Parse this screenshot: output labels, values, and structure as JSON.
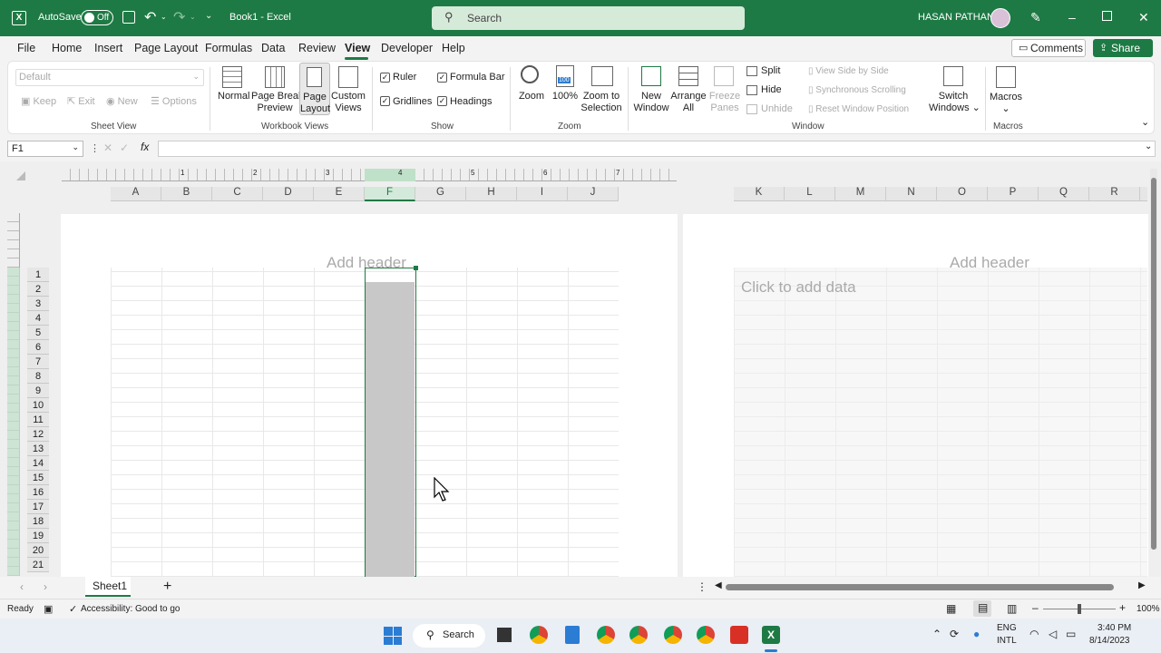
{
  "titlebar": {
    "autosave_label": "AutoSave",
    "autosave_state": "Off",
    "doc_title": "Book1 - Excel",
    "search_placeholder": "Search",
    "user_name": "HASAN PATHAN"
  },
  "menu": {
    "items": [
      "File",
      "Home",
      "Insert",
      "Page Layout",
      "Formulas",
      "Data",
      "Review",
      "View",
      "Developer",
      "Help"
    ],
    "active": "View",
    "comments_label": "Comments",
    "share_label": "Share"
  },
  "ribbon": {
    "sheet_view": {
      "dropdown_value": "Default",
      "keep": "Keep",
      "exit": "Exit",
      "new": "New",
      "options": "Options",
      "group_label": "Sheet View"
    },
    "workbook_views": {
      "normal": "Normal",
      "page_break_1": "Page Break",
      "page_break_2": "Preview",
      "page_layout_1": "Page",
      "page_layout_2": "Layout",
      "custom_1": "Custom",
      "custom_2": "Views",
      "group_label": "Workbook Views"
    },
    "show": {
      "ruler": "Ruler",
      "formula_bar": "Formula Bar",
      "gridlines": "Gridlines",
      "headings": "Headings",
      "group_label": "Show"
    },
    "zoom": {
      "zoom": "Zoom",
      "hundred": "100%",
      "icon_badge": "100",
      "zoom_sel_1": "Zoom to",
      "zoom_sel_2": "Selection",
      "group_label": "Zoom"
    },
    "window": {
      "new_window_1": "New",
      "new_window_2": "Window",
      "arrange_1": "Arrange",
      "arrange_2": "All",
      "freeze_1": "Freeze",
      "freeze_2": "Panes",
      "split": "Split",
      "hide": "Hide",
      "unhide": "Unhide",
      "view_side": "View Side by Side",
      "sync_scroll": "Synchronous Scrolling",
      "reset_pos": "Reset Window Position",
      "switch_1": "Switch",
      "switch_2": "Windows",
      "group_label": "Window"
    },
    "macros": {
      "label": "Macros",
      "group_label": "Macros"
    }
  },
  "formula_bar": {
    "name_box": "F1",
    "fx": "fx"
  },
  "ruler_numbers": [
    "1",
    "2",
    "3",
    "4",
    "5",
    "6",
    "7"
  ],
  "columns_left": [
    "A",
    "B",
    "C",
    "D",
    "E",
    "F",
    "G",
    "H",
    "I",
    "J"
  ],
  "columns_right": [
    "K",
    "L",
    "M",
    "N",
    "O",
    "P",
    "Q",
    "R"
  ],
  "rows": [
    "1",
    "2",
    "3",
    "4",
    "5",
    "6",
    "7",
    "8",
    "9",
    "10",
    "11",
    "12",
    "13",
    "14",
    "15",
    "16",
    "17",
    "18",
    "19",
    "20",
    "21"
  ],
  "page": {
    "add_header": "Add header",
    "click_to_add": "Click to add data"
  },
  "sheet_tab": "Sheet1",
  "status": {
    "ready": "Ready",
    "accessibility": "Accessibility: Good to go",
    "zoom_level": "100%"
  },
  "taskbar": {
    "search": "Search",
    "lang_1": "ENG",
    "lang_2": "INTL",
    "time": "3:40 PM",
    "date": "8/14/2023"
  },
  "colors": {
    "excel_green": "#1e7a44",
    "selection": "#c8c8c8"
  }
}
